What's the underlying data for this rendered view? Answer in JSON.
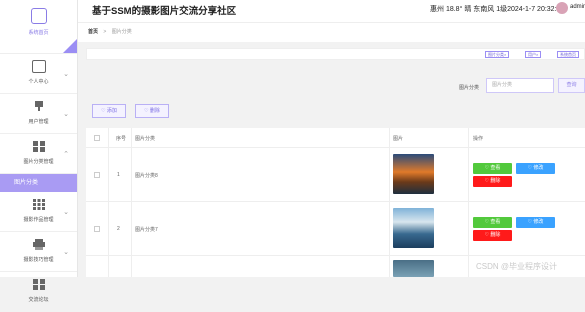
{
  "app_title": "基于SSM的摄影图片交流分享社区",
  "weather": "惠州 18.8° 晴 东南风 1级2024-1-7 20:32:42",
  "user": "admin",
  "breadcrumb": {
    "home": "首页",
    "sep": ">",
    "current": "图片分类"
  },
  "tags": [
    "图片分类×",
    "用户×",
    "系统首页"
  ],
  "sidebar": {
    "home": "系统首页",
    "items": [
      {
        "label": "个人中心",
        "icon": "profile-icon"
      },
      {
        "label": "用户管理",
        "icon": "user-icon"
      },
      {
        "label": "图片分类管理",
        "icon": "grid-icon"
      }
    ],
    "active_sub": "图片分类",
    "rest": [
      {
        "label": "摄影作品管理",
        "icon": "grid-icon"
      },
      {
        "label": "摄影技巧管理",
        "icon": "printer-icon"
      },
      {
        "label": "交流论坛",
        "icon": "grid-icon"
      }
    ]
  },
  "search": {
    "label": "图片分类",
    "placeholder": "图片分类",
    "button": "查询"
  },
  "actions": {
    "add": "添加",
    "delete": "删除"
  },
  "table": {
    "headers": [
      "序号",
      "图片分类",
      "图片",
      "操作"
    ],
    "rows": [
      {
        "index": "1",
        "category": "图片分类8"
      },
      {
        "index": "2",
        "category": "图片分类7"
      }
    ],
    "row_actions": {
      "view": "查看",
      "edit": "修改",
      "delete": "删除"
    }
  },
  "watermark": "CSDN @毕业程序设计"
}
